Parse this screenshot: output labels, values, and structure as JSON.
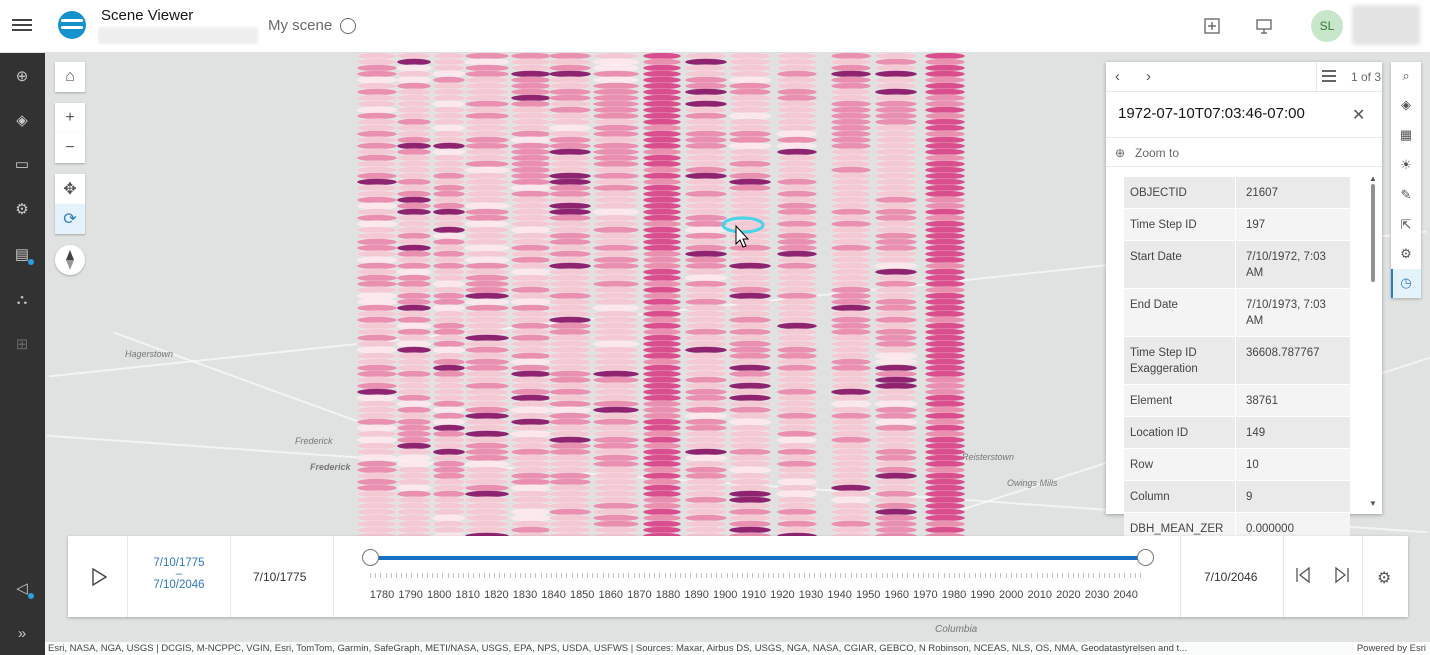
{
  "header": {
    "app_title": "Scene Viewer",
    "scene_name": "My scene",
    "avatar_initials": "SL"
  },
  "left_sidebar": {
    "icons": [
      "add-icon",
      "layers-icon",
      "slides-icon",
      "settings-icon",
      "save-icon",
      "share-icon",
      "grid-icon",
      "feedback-icon",
      "expand-icon"
    ]
  },
  "map": {
    "labels": [
      "Frederick",
      "Frederick",
      "Hagerstown",
      "Reisterstown",
      "Owings Mills",
      "Columbia"
    ],
    "colors": {
      "column_light": "#f3c9d4",
      "column_mid": "#e98fb0",
      "column_dark": "#8e2470",
      "column_hot": "#d94f8d",
      "highlight": "#45d4e8"
    }
  },
  "popup": {
    "page_counter": "1 of 3",
    "title": "1972-07-10T07:03:46-07:00",
    "zoom_to": "Zoom to",
    "attributes": [
      {
        "key": "OBJECTID",
        "value": "21607"
      },
      {
        "key": "Time Step ID",
        "value": "197"
      },
      {
        "key": "Start Date",
        "value": "7/10/1972, 7:03 AM"
      },
      {
        "key": "End Date",
        "value": "7/10/1973, 7:03 AM"
      },
      {
        "key": "Time Step ID Exaggeration",
        "value": "36608.787767"
      },
      {
        "key": "Element",
        "value": "38761"
      },
      {
        "key": "Location ID",
        "value": "149"
      },
      {
        "key": "Row",
        "value": "10"
      },
      {
        "key": "Column",
        "value": "9"
      },
      {
        "key": "DBH_MEAN_ZEROS",
        "value": "0.000000"
      }
    ]
  },
  "time_slider": {
    "range_start": "7/10/1775",
    "range_dash": "–",
    "range_end": "7/10/2046",
    "start_label": "7/10/1775",
    "end_label": "7/10/2046",
    "years": [
      "1780",
      "1790",
      "1800",
      "1810",
      "1820",
      "1830",
      "1840",
      "1850",
      "1860",
      "1870",
      "1880",
      "1890",
      "1900",
      "1910",
      "1920",
      "1930",
      "1940",
      "1950",
      "1960",
      "1970",
      "1980",
      "1990",
      "2000",
      "2010",
      "2020",
      "2030",
      "2040"
    ],
    "selected_range_fraction": [
      0.0,
      1.0
    ]
  },
  "attribution": {
    "text": "Esri, NASA, NGA, USGS | DCGIS, M-NCPPC, VGIN, Esri, TomTom, Garmin, SafeGraph, METI/NASA, USGS, EPA, NPS, USDA, USFWS | Sources: Maxar, Airbus DS, USGS, NGA, NASA, CGIAR, GEBCO, N Robinson, NCEAS, NLS, OS, NMA, Geodatastyrelsen and t...",
    "powered_by": "Powered by Esri"
  }
}
